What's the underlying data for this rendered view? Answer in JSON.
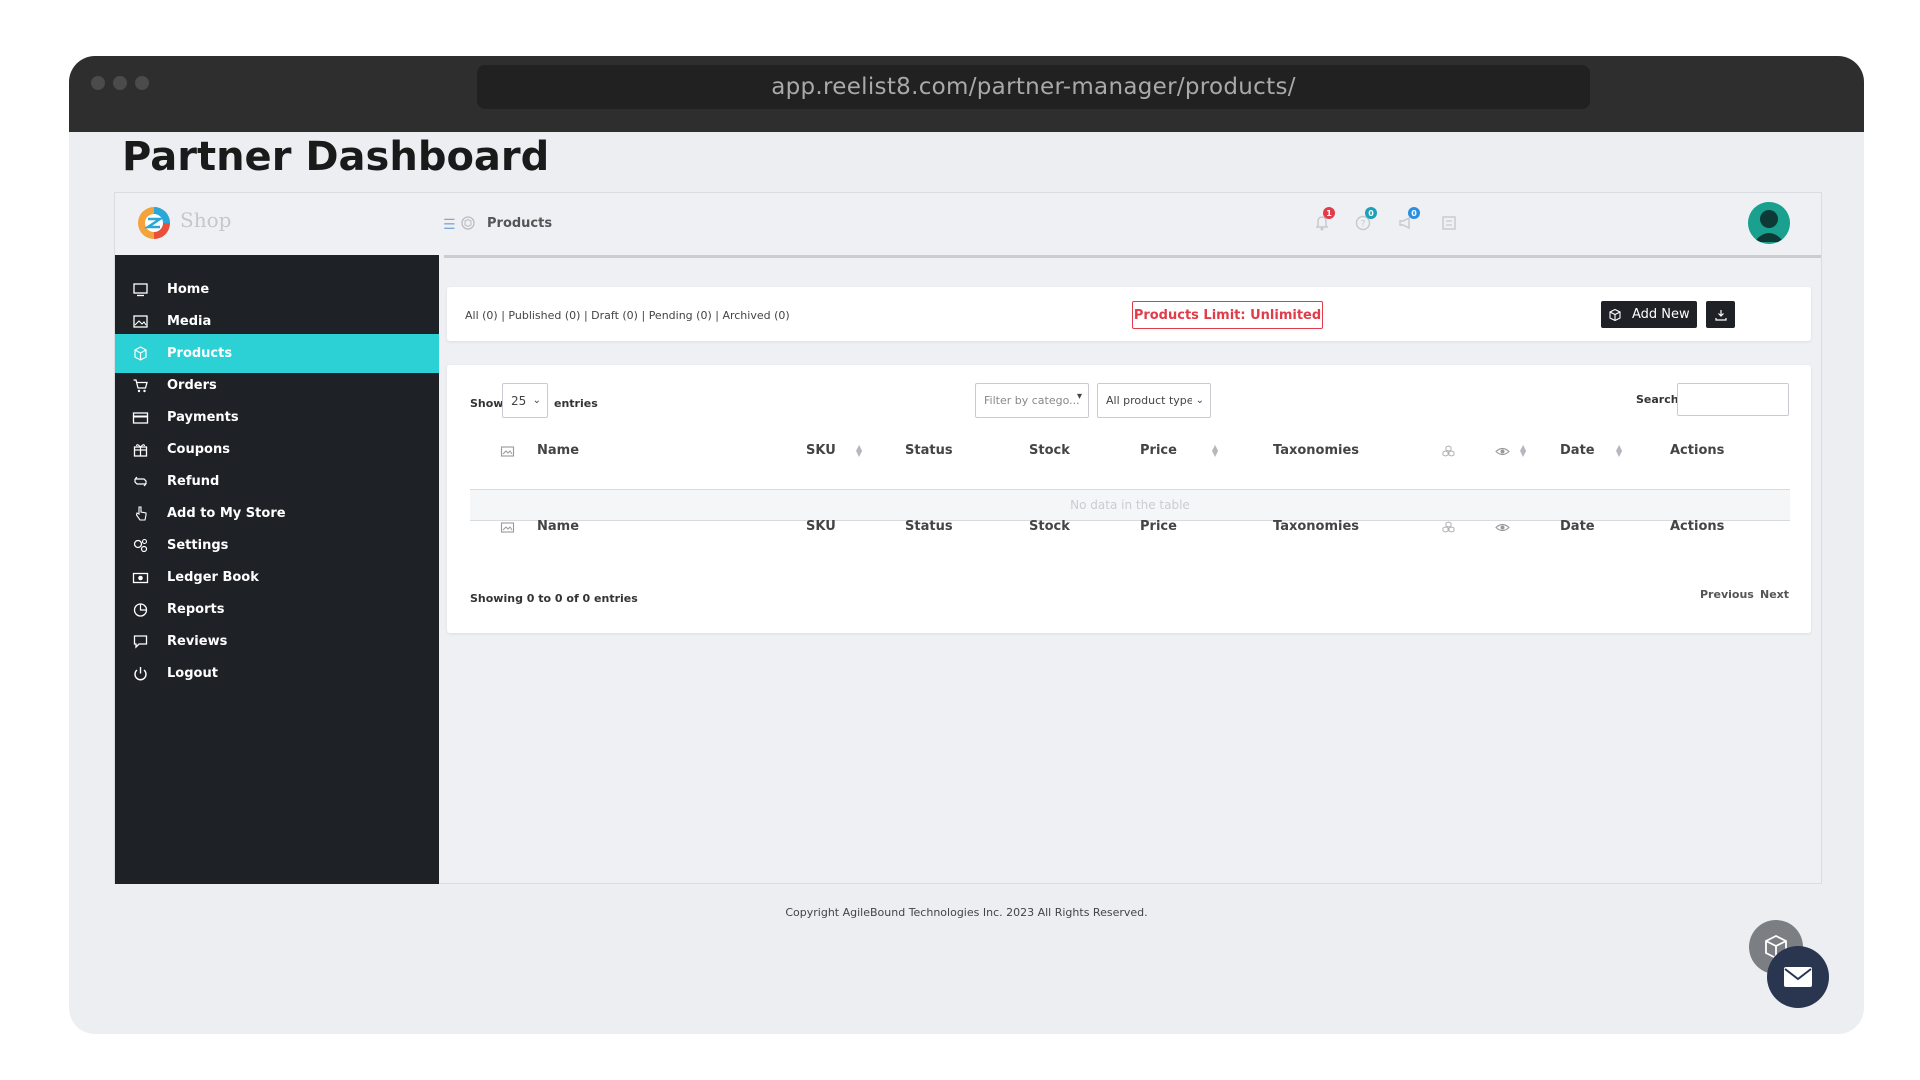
{
  "browser": {
    "url": "app.reelist8.com/partner-manager/products/"
  },
  "page": {
    "title": "Partner Dashboard"
  },
  "topbar": {
    "logo_text": "Shop",
    "breadcrumb": "Products",
    "notifications": {
      "count": "1",
      "color": "#e23b4a"
    },
    "help": {
      "count": "0",
      "color": "#1aa0b8"
    },
    "announcements": {
      "count": "0",
      "color": "#2a8fe0"
    }
  },
  "sidebar": {
    "items": [
      {
        "label": "Home",
        "icon": "monitor-icon"
      },
      {
        "label": "Media",
        "icon": "image-icon"
      },
      {
        "label": "Products",
        "icon": "cube-icon",
        "active": true
      },
      {
        "label": "Orders",
        "icon": "cart-icon"
      },
      {
        "label": "Payments",
        "icon": "credit-card-icon"
      },
      {
        "label": "Coupons",
        "icon": "gift-icon"
      },
      {
        "label": "Refund",
        "icon": "refund-icon"
      },
      {
        "label": "Add to My Store",
        "icon": "hand-pointer-icon"
      },
      {
        "label": "Settings",
        "icon": "gears-icon"
      },
      {
        "label": "Ledger Book",
        "icon": "money-bill-icon"
      },
      {
        "label": "Reports",
        "icon": "chart-pie-icon"
      },
      {
        "label": "Reviews",
        "icon": "comment-icon"
      },
      {
        "label": "Logout",
        "icon": "power-icon"
      }
    ]
  },
  "filters": {
    "all": "All (0)",
    "published": "Published (0)",
    "draft": "Draft (0)",
    "pending": "Pending (0)",
    "archived": "Archived (0)",
    "separator": " | ",
    "limit": "Products Limit: Unlimited",
    "add_new": "Add New"
  },
  "table": {
    "show_label": "Show",
    "entries_value": "25",
    "entries_label": "entries",
    "category_filter": "Filter by catego...",
    "type_filter": "All product types",
    "search_label": "Search:",
    "columns": {
      "name": "Name",
      "sku": "SKU",
      "status": "Status",
      "stock": "Stock",
      "price": "Price",
      "taxonomies": "Taxonomies",
      "date": "Date",
      "actions": "Actions"
    },
    "empty_message": "No data in the table",
    "info": "Showing 0 to 0 of 0 entries",
    "previous": "Previous",
    "next": "Next"
  },
  "footer": {
    "copyright": "Copyright AgileBound Technologies Inc. 2023   All Rights Reserved."
  },
  "colors": {
    "accent": "#2cd1d5",
    "sidebar": "#1e2125",
    "limit": "#e23b4a"
  }
}
